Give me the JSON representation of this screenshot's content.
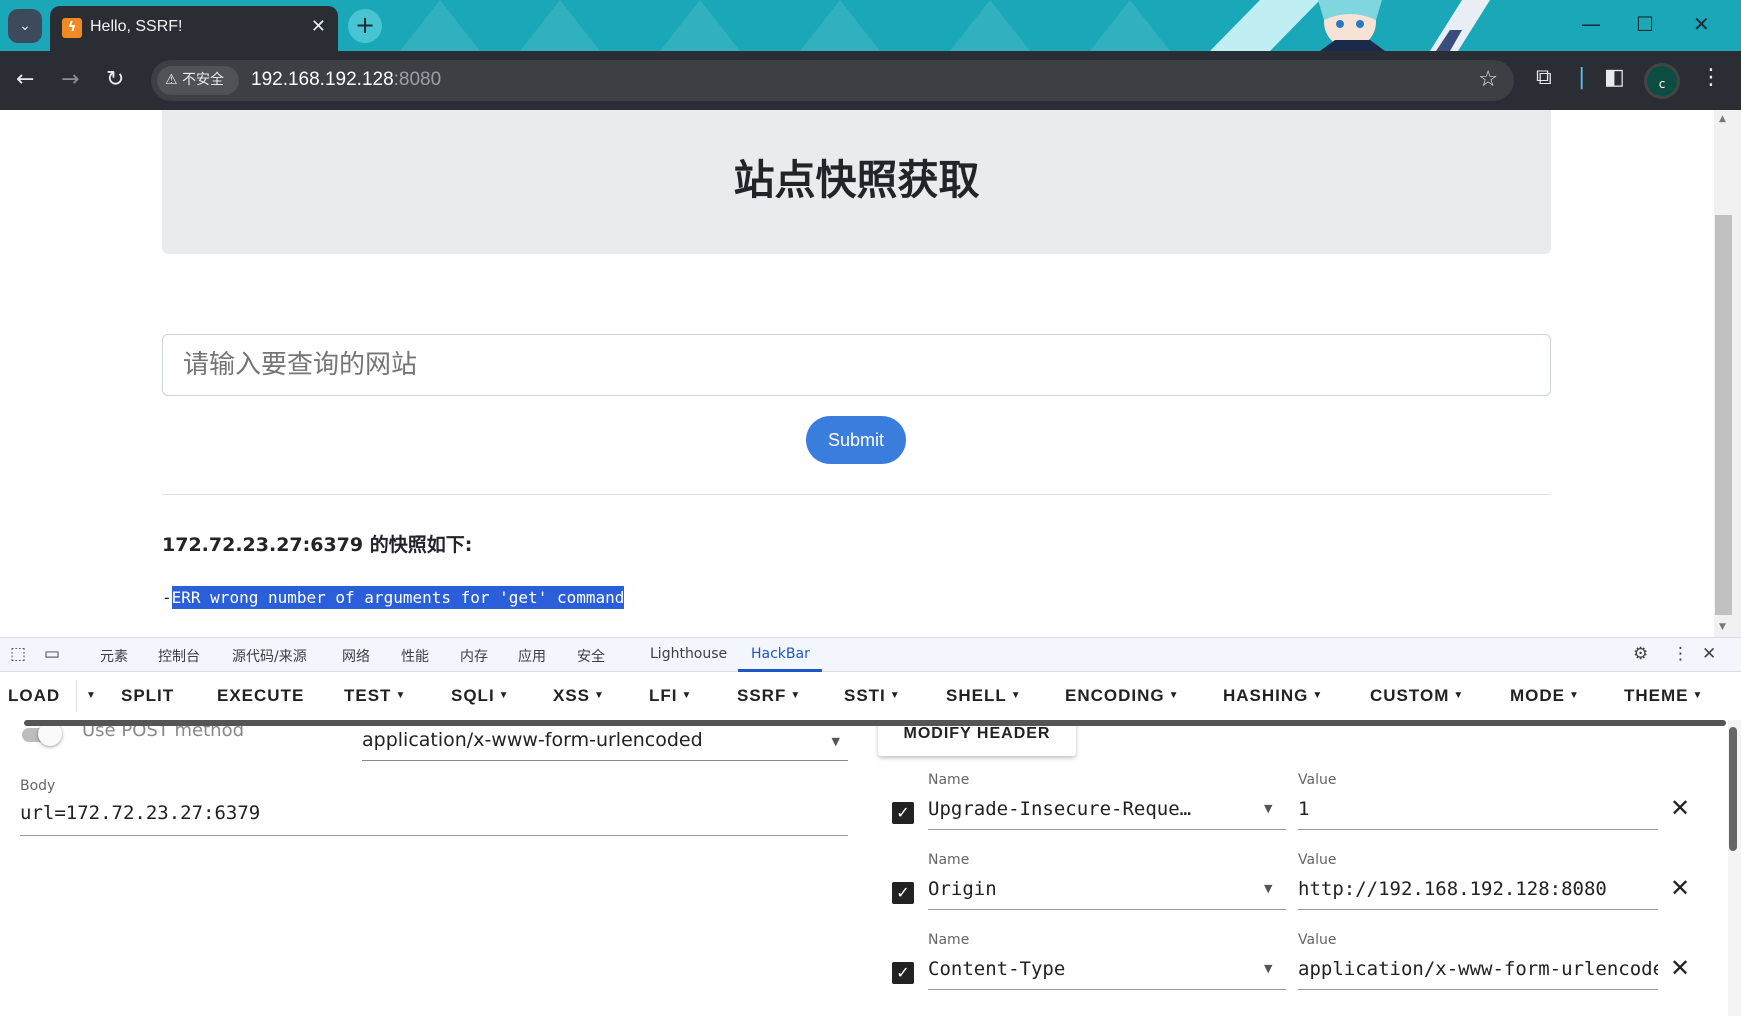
{
  "browser": {
    "tab_title": "Hello, SSRF!",
    "new_tab_symbol": "+",
    "security_label": "不安全",
    "url_host": "192.168.192.128",
    "url_port": ":8080",
    "profile_initial": "c"
  },
  "page": {
    "title": "站点快照获取",
    "input_placeholder": "请输入要查询的网站",
    "submit_label": "Submit",
    "result_label": "172.72.23.27:6379 的快照如下:",
    "result_prefix": "-",
    "result_text": "ERR wrong number of arguments for 'get' command"
  },
  "devtools": {
    "tabs": [
      "元素",
      "控制台",
      "源代码/来源",
      "网络",
      "性能",
      "内存",
      "应用",
      "安全",
      "Lighthouse",
      "HackBar"
    ],
    "active_tab": "HackBar"
  },
  "hackbar": {
    "menu": {
      "load": "LOAD",
      "split": "SPLIT",
      "execute": "EXECUTE",
      "test": "TEST",
      "sqli": "SQLI",
      "xss": "XSS",
      "lfi": "LFI",
      "ssrf": "SSRF",
      "ssti": "SSTI",
      "shell": "SHELL",
      "encoding": "ENCODING",
      "hashing": "HASHING",
      "custom": "CUSTOM",
      "mode": "MODE",
      "theme": "THEME"
    },
    "post_method_label": "Use POST method",
    "post_enabled": false,
    "enctype": "application/x-www-form-urlencoded",
    "modify_header_label": "MODIFY HEADER",
    "body_label": "Body",
    "body_value": "url=172.72.23.27:6379",
    "name_label": "Name",
    "value_label": "Value",
    "headers": [
      {
        "name": "Upgrade-Insecure-Reque…",
        "value": "1",
        "checked": true
      },
      {
        "name": "Origin",
        "value": "http://192.168.192.128:8080",
        "checked": true
      },
      {
        "name": "Content-Type",
        "value": "application/x-www-form-urlencoded",
        "checked": true
      }
    ]
  },
  "colors": {
    "tabbar": "#1aa8b8",
    "chrome_dark": "#2a2e34",
    "submit_blue": "#3b7ddd",
    "selection": "#2b5fd9",
    "devtools_active": "#1a57c9"
  }
}
